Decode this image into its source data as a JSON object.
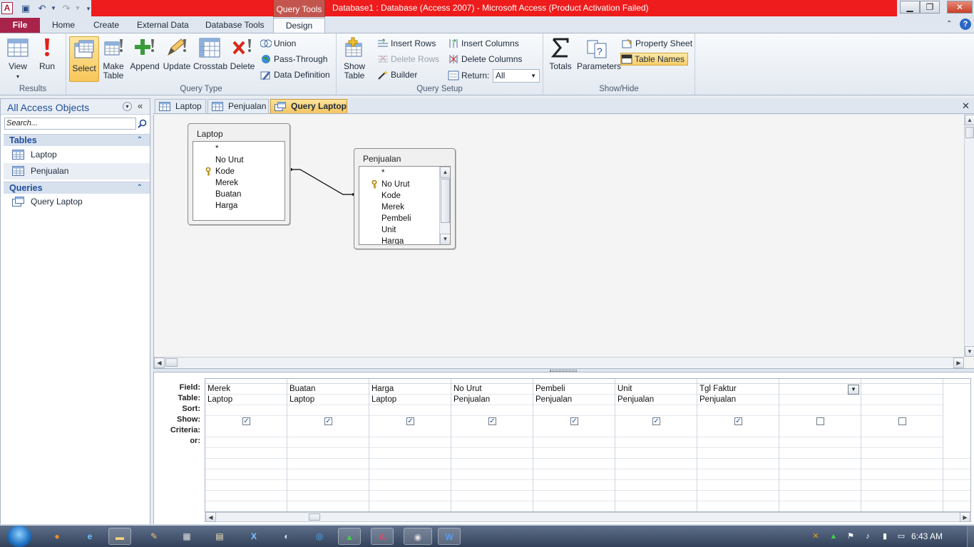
{
  "app": {
    "icon_letter": "A",
    "context_tab": "Query Tools",
    "window_title": "Database1 : Database (Access 2007)  -  Microsoft Access (Product Activation Failed)",
    "minimize": "▁",
    "maximize": "❐",
    "close": "✕"
  },
  "ribbon_tabs": {
    "file": "File",
    "home": "Home",
    "create": "Create",
    "external_data": "External Data",
    "database_tools": "Database Tools",
    "design": "Design"
  },
  "ribbon": {
    "results": {
      "label": "Results",
      "view": "View",
      "run": "Run"
    },
    "query_type": {
      "label": "Query Type",
      "select": "Select",
      "make_table_1": "Make",
      "make_table_2": "Table",
      "append": "Append",
      "update": "Update",
      "crosstab": "Crosstab",
      "delete": "Delete",
      "union": "Union",
      "pass_through": "Pass-Through",
      "data_definition": "Data Definition"
    },
    "query_setup": {
      "label": "Query Setup",
      "show_table_1": "Show",
      "show_table_2": "Table",
      "insert_rows": "Insert Rows",
      "delete_rows": "Delete Rows",
      "builder": "Builder",
      "insert_columns": "Insert Columns",
      "delete_columns": "Delete Columns",
      "return_label": "Return:",
      "return_value": "All"
    },
    "show_hide": {
      "label": "Show/Hide",
      "totals": "Totals",
      "parameters": "Parameters",
      "property_sheet": "Property Sheet",
      "table_names": "Table Names"
    }
  },
  "nav": {
    "title": "All Access Objects",
    "search_placeholder": "Search...",
    "tables_header": "Tables",
    "tables": [
      "Laptop",
      "Penjualan"
    ],
    "queries_header": "Queries",
    "queries": [
      "Query Laptop"
    ]
  },
  "doc_tabs": [
    "Laptop",
    "Penjualan",
    "Query Laptop"
  ],
  "field_lists": [
    {
      "title": "Laptop",
      "fields": [
        "*",
        "No Urut",
        "Kode",
        "Merek",
        "Buatan",
        "Harga"
      ],
      "key_field": "Kode"
    },
    {
      "title": "Penjualan",
      "fields": [
        "*",
        "No Urut",
        "Kode",
        "Merek",
        "Pembeli",
        "Unit",
        "Harga"
      ],
      "key_field": "No Urut"
    }
  ],
  "grid": {
    "row_labels": [
      "Field:",
      "Table:",
      "Sort:",
      "Show:",
      "Criteria:",
      "or:"
    ],
    "columns": [
      {
        "field": "Merek",
        "table": "Laptop",
        "show": true
      },
      {
        "field": "Buatan",
        "table": "Laptop",
        "show": true
      },
      {
        "field": "Harga",
        "table": "Laptop",
        "show": true
      },
      {
        "field": "No Urut",
        "table": "Penjualan",
        "show": true
      },
      {
        "field": "Pembeli",
        "table": "Penjualan",
        "show": true
      },
      {
        "field": "Unit",
        "table": "Penjualan",
        "show": true
      },
      {
        "field": "Tgl Faktur",
        "table": "Penjualan",
        "show": true
      },
      {
        "field": "",
        "table": "",
        "show": false
      },
      {
        "field": "",
        "table": "",
        "show": false
      }
    ]
  },
  "taskbar": {
    "clock": "6:43 AM"
  }
}
